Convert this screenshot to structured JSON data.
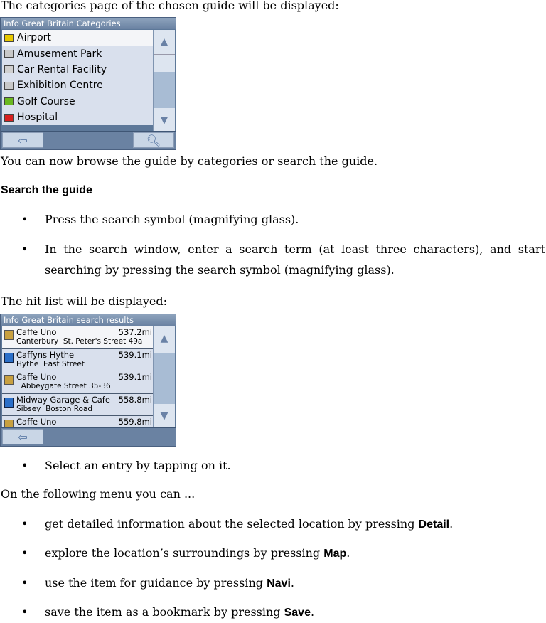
{
  "intro": "The categories page of the chosen guide will be displayed:",
  "categories_widget": {
    "title": "Info Great Britain Categories",
    "items": [
      {
        "label": "Airport",
        "icon": "airport-icon",
        "color": "#e8c800"
      },
      {
        "label": "Amusement Park",
        "icon": "ticket-icon",
        "color": "#c8c8c8"
      },
      {
        "label": "Car Rental Facility",
        "icon": "car-icon",
        "color": "#d0d0d0"
      },
      {
        "label": "Exhibition Centre",
        "icon": "ticket-icon",
        "color": "#c8c8c8"
      },
      {
        "label": "Golf Course",
        "icon": "golf-icon",
        "color": "#6ab820"
      },
      {
        "label": "Hospital",
        "icon": "hospital-icon",
        "color": "#d82020"
      }
    ],
    "selected": "Airport"
  },
  "after_categories": "You can now browse the guide by categories or search the guide.",
  "search_heading": "Search the guide",
  "search_steps": [
    "Press the search symbol (magnifying glass).",
    "In the search window, enter a search term (at least three characters), and start searching by pressing the search symbol (magnifying glass)."
  ],
  "hit_list_intro": "The hit list will be displayed:",
  "results_widget": {
    "title": "Info Great Britain search results",
    "rows": [
      {
        "name": "Caffe Uno",
        "address": "Canterbury  St. Peter's Street 49a",
        "distance": "537.2mi",
        "icon": "cafe-icon"
      },
      {
        "name": "Caffyns Hythe",
        "address": "Hythe  East Street",
        "distance": "539.1mi",
        "icon": "fuel-icon"
      },
      {
        "name": "Caffe Uno",
        "address": "  Abbeygate Street 35-36",
        "distance": "539.1mi",
        "icon": "cafe-icon"
      },
      {
        "name": "Midway Garage & Cafe",
        "address": "Sibsey  Boston Road",
        "distance": "558.8mi",
        "icon": "fuel-icon"
      },
      {
        "name": "Caffe Uno",
        "address": "",
        "distance": "559.8mi",
        "icon": "cafe-icon"
      }
    ]
  },
  "select_step": "Select an entry by tapping on it.",
  "menu_intro": "On the following menu you can ...",
  "menu_items": [
    {
      "pre": "get detailed information about the selected location by pressing ",
      "key": "Detail",
      "post": "."
    },
    {
      "pre": "explore the location’s surroundings by pressing ",
      "key": "Map",
      "post": "."
    },
    {
      "pre": "use the item for guidance by pressing ",
      "key": "Navi",
      "post": "."
    },
    {
      "pre": "save the item as a bookmark by pressing ",
      "key": "Save",
      "post": "."
    }
  ]
}
